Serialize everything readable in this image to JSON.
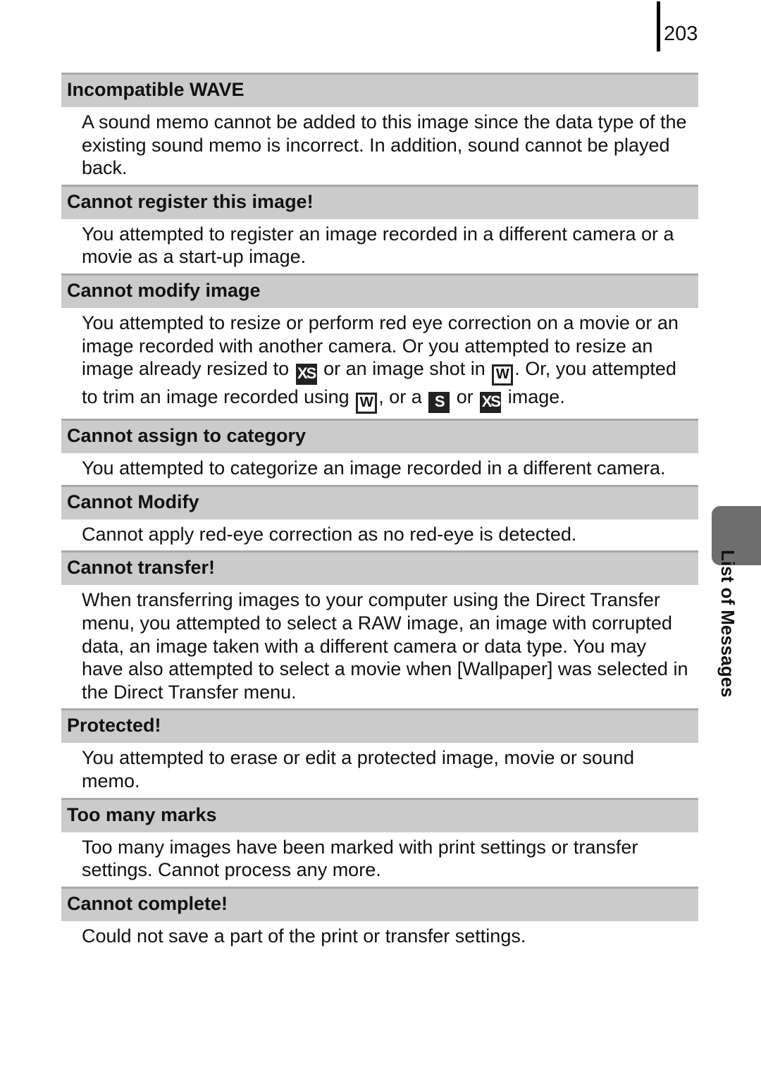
{
  "page": {
    "number": "203",
    "section_tab": "List of Messages"
  },
  "messages": [
    {
      "title": "Incompatible WAVE",
      "body": [
        "A sound memo cannot be added to this image since the data type of the existing sound memo is incorrect. In addition, sound cannot be played back."
      ]
    },
    {
      "title": "Cannot register this image!",
      "body": [
        "You attempted to register an image recorded in a different camera or a movie as a start-up image."
      ]
    },
    {
      "title": "Cannot modify image",
      "parts": {
        "t1": "You attempted to resize or perform red eye correction on a movie or an image recorded with another camera. Or you attempted to resize an image already resized to ",
        "i1": "XS",
        "t2": " or an image shot in ",
        "i2": "W",
        "t3": ". Or, you attempted to trim an image recorded using ",
        "i3": "W",
        "t4": ", or a ",
        "i4": "S",
        "t5": " or ",
        "i5": "XS",
        "t6": " image."
      }
    },
    {
      "title": "Cannot assign to category",
      "body": [
        "You attempted to categorize an image recorded in a different camera."
      ]
    },
    {
      "title": "Cannot Modify",
      "body": [
        "Cannot apply red-eye correction as no red-eye is detected."
      ]
    },
    {
      "title": "Cannot transfer!",
      "body": [
        "When transferring images to your computer using the Direct Transfer menu, you attempted to select a RAW image, an image with corrupted data, an image taken with a different camera or data type. You may have also attempted to select a movie when [Wallpaper] was selected in the Direct Transfer menu."
      ]
    },
    {
      "title": "Protected!",
      "body": [
        "You attempted to erase or edit a protected image, movie or sound memo."
      ]
    },
    {
      "title": "Too many marks",
      "body": [
        "Too many images have been marked with print settings or transfer settings. Cannot process any more."
      ]
    },
    {
      "title": "Cannot complete!",
      "body": [
        "Could not save a part of the print or transfer settings."
      ]
    }
  ]
}
